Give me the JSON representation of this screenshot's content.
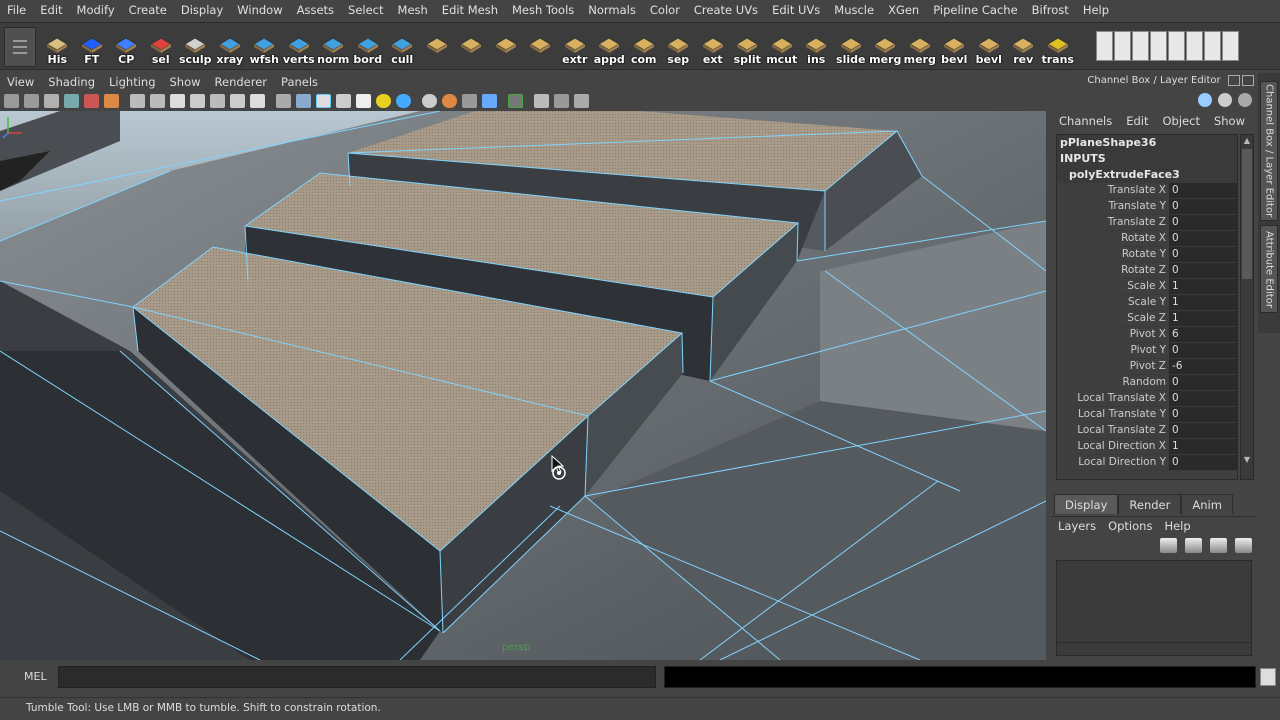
{
  "menubar": {
    "items": [
      "File",
      "Edit",
      "Modify",
      "Create",
      "Display",
      "Window",
      "Assets",
      "Select",
      "Mesh",
      "Edit Mesh",
      "Mesh Tools",
      "Normals",
      "Color",
      "Create UVs",
      "Edit UVs",
      "Muscle",
      "XGen",
      "Pipeline Cache",
      "Bifrost",
      "Help"
    ]
  },
  "shelf": {
    "tools": [
      {
        "label": "His",
        "icon": "history-icon",
        "color": "#d8c080"
      },
      {
        "label": "FT",
        "icon": "freeze-transforms-icon",
        "color": "#2060ff"
      },
      {
        "label": "CP",
        "icon": "center-pivot-icon",
        "color": "#4080ff"
      },
      {
        "label": "sel",
        "icon": "select-icon",
        "color": "#e04040"
      },
      {
        "label": "sculp",
        "icon": "sculpt-icon",
        "color": "#d0d0d0"
      },
      {
        "label": "xray",
        "icon": "xray-icon",
        "color": "#40a0e0"
      },
      {
        "label": "wfsh",
        "icon": "wireframe-shaded-icon",
        "color": "#40a0e0"
      },
      {
        "label": "verts",
        "icon": "vertices-icon",
        "color": "#40a0e0"
      },
      {
        "label": "norm",
        "icon": "normals-icon",
        "color": "#40a0e0"
      },
      {
        "label": "bord",
        "icon": "border-edges-icon",
        "color": "#40a0e0"
      },
      {
        "label": "cull",
        "icon": "backface-cull-icon",
        "color": "#40a0e0"
      },
      {
        "label": "",
        "icon": "poly-plane-icon",
        "color": "#d8b060"
      },
      {
        "label": "",
        "icon": "poly-cube-icon",
        "color": "#d8b060"
      },
      {
        "label": "",
        "icon": "poly-sphere-icon",
        "color": "#d8b060"
      },
      {
        "label": "",
        "icon": "poly-cylinder-icon",
        "color": "#d8b060"
      },
      {
        "label": "extr",
        "icon": "extrude-icon",
        "color": "#d8b060"
      },
      {
        "label": "appd",
        "icon": "append-poly-icon",
        "color": "#d8b060"
      },
      {
        "label": "com",
        "icon": "combine-icon",
        "color": "#d8b060"
      },
      {
        "label": "sep",
        "icon": "separate-icon",
        "color": "#d8b060"
      },
      {
        "label": "ext",
        "icon": "extract-icon",
        "color": "#d8b060"
      },
      {
        "label": "split",
        "icon": "split-poly-icon",
        "color": "#d8b060"
      },
      {
        "label": "mcut",
        "icon": "multi-cut-icon",
        "color": "#d8b060"
      },
      {
        "label": "ins",
        "icon": "insert-edge-loop-icon",
        "color": "#d8b060"
      },
      {
        "label": "slide",
        "icon": "slide-edge-icon",
        "color": "#d8b060"
      },
      {
        "label": "merg",
        "icon": "merge-icon",
        "color": "#d8b060"
      },
      {
        "label": "merg",
        "icon": "merge-to-center-icon",
        "color": "#d8b060"
      },
      {
        "label": "bevl",
        "icon": "bevel-icon",
        "color": "#d8b060"
      },
      {
        "label": "bevl",
        "icon": "bevel-plus-icon",
        "color": "#d8b060"
      },
      {
        "label": "rev",
        "icon": "reverse-normals-icon",
        "color": "#d8b060"
      },
      {
        "label": "trans",
        "icon": "transfer-attributes-icon",
        "color": "#e0c020"
      }
    ]
  },
  "panel": {
    "menu": [
      "View",
      "Shading",
      "Lighting",
      "Show",
      "Renderer",
      "Panels"
    ],
    "camera": "persp"
  },
  "channel_box": {
    "title": "Channel Box / Layer Editor",
    "menu": [
      "Channels",
      "Edit",
      "Object",
      "Show"
    ],
    "shape": "pPlaneShape36",
    "inputs_label": "INPUTS",
    "node": "polyExtrudeFace3",
    "rows": [
      {
        "label": "Translate X",
        "value": "0"
      },
      {
        "label": "Translate Y",
        "value": "0"
      },
      {
        "label": "Translate Z",
        "value": "0"
      },
      {
        "label": "Rotate X",
        "value": "0"
      },
      {
        "label": "Rotate Y",
        "value": "0"
      },
      {
        "label": "Rotate Z",
        "value": "0"
      },
      {
        "label": "Scale X",
        "value": "1"
      },
      {
        "label": "Scale Y",
        "value": "1"
      },
      {
        "label": "Scale Z",
        "value": "1"
      },
      {
        "label": "Pivot X",
        "value": "6"
      },
      {
        "label": "Pivot Y",
        "value": "0"
      },
      {
        "label": "Pivot Z",
        "value": "-6"
      },
      {
        "label": "Random",
        "value": "0"
      },
      {
        "label": "Local Translate X",
        "value": "0"
      },
      {
        "label": "Local Translate Y",
        "value": "0"
      },
      {
        "label": "Local Translate Z",
        "value": "0"
      },
      {
        "label": "Local Direction X",
        "value": "1"
      },
      {
        "label": "Local Direction Y",
        "value": "0"
      }
    ]
  },
  "side_tabs": [
    "Channel Box / Layer Editor",
    "Attribute Editor"
  ],
  "layer_editor": {
    "tabs": [
      "Display",
      "Render",
      "Anim"
    ],
    "active_tab": "Display",
    "menu": [
      "Layers",
      "Options",
      "Help"
    ]
  },
  "command_line": {
    "label": "MEL",
    "value": ""
  },
  "help_line": {
    "text": "Tumble Tool: Use LMB or MMB to tumble. Shift to constrain rotation."
  },
  "colors": {
    "wireframe": "#7fd4ff",
    "top_face": "#a89a88",
    "ui_bg": "#444444"
  }
}
